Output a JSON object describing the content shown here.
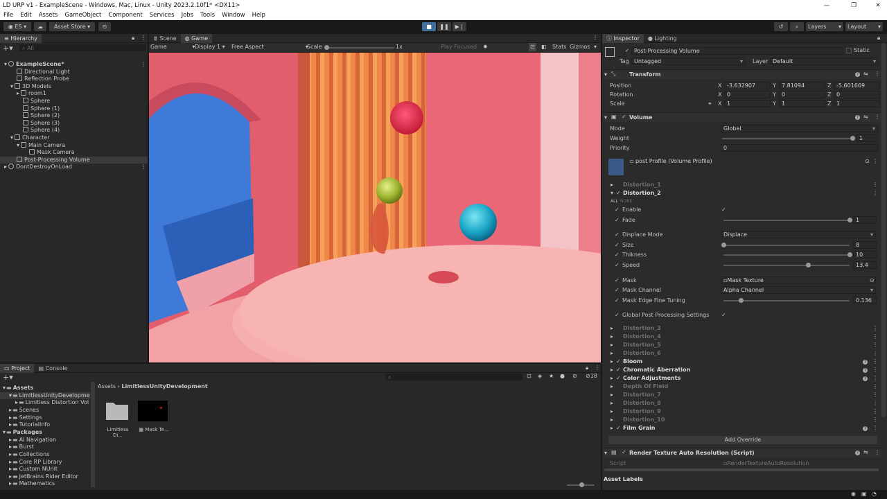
{
  "window": {
    "title": "LD URP v1 - ExampleScene - Windows, Mac, Linux - Unity 2023.2.10f1* <DX11>"
  },
  "menu": [
    "File",
    "Edit",
    "Assets",
    "GameObject",
    "Component",
    "Services",
    "Jobs",
    "Tools",
    "Window",
    "Help"
  ],
  "toolbar": {
    "account": "ES",
    "asset_store": "Asset Store",
    "layers": "Layers",
    "layout": "Layout"
  },
  "hierarchy": {
    "tab": "Hierarchy",
    "search_placeholder": "All",
    "items": [
      {
        "label": "ExampleScene*",
        "depth": 0,
        "bold": true,
        "expand": true,
        "type": "scene"
      },
      {
        "label": "Directional Light",
        "depth": 1
      },
      {
        "label": "Reflection Probe",
        "depth": 1
      },
      {
        "label": "3D Models",
        "depth": 1,
        "expand": true
      },
      {
        "label": "room1",
        "depth": 2,
        "expand": false
      },
      {
        "label": "Sphere",
        "depth": 2
      },
      {
        "label": "Sphere (1)",
        "depth": 2
      },
      {
        "label": "Sphere (2)",
        "depth": 2
      },
      {
        "label": "Sphere (3)",
        "depth": 2
      },
      {
        "label": "Sphere (4)",
        "depth": 2
      },
      {
        "label": "Character",
        "depth": 1,
        "expand": true
      },
      {
        "label": "Main Camera",
        "depth": 2,
        "expand": true
      },
      {
        "label": "Mask Camera",
        "depth": 3
      },
      {
        "label": "Post-Processing Volume",
        "depth": 1,
        "selected": true
      },
      {
        "label": "DontDestroyOnLoad",
        "depth": 0,
        "expand": false,
        "type": "scene"
      }
    ]
  },
  "game": {
    "tabs": [
      "Scene",
      "Game"
    ],
    "bar": {
      "mode": "Game",
      "display": "Display 1",
      "aspect": "Free Aspect",
      "scale_label": "Scale",
      "scale_value": "1x",
      "play_focused": "Play Focused",
      "stats": "Stats",
      "gizmos": "Gizmos"
    }
  },
  "inspector": {
    "tabs": [
      "Inspector",
      "Lighting"
    ],
    "object_name": "Post-Processing Volume",
    "static": "Static",
    "tag_label": "Tag",
    "tag": "Untagged",
    "layer_label": "Layer",
    "layer": "Default",
    "transform": {
      "title": "Transform",
      "position_label": "Position",
      "px": "-3.632907",
      "py": "7.81094",
      "pz": "-5.601669",
      "rotation_label": "Rotation",
      "rx": "0",
      "ry": "0",
      "rz": "0",
      "scale_label": "Scale",
      "sx": "1",
      "sy": "1",
      "sz": "1"
    },
    "volume": {
      "title": "Volume",
      "mode_label": "Mode",
      "mode": "Global",
      "weight_label": "Weight",
      "weight": "1",
      "weight_frac": 1.0,
      "priority_label": "Priority",
      "priority": "0",
      "profile": "post Profile (Volume Profile)"
    },
    "overrides_top": [
      "Distortion_1"
    ],
    "distortion2": {
      "title": "Distortion_2",
      "all": "ALL",
      "none": "NONE",
      "enable_label": "Enable",
      "fade_label": "Fade",
      "fade": "1",
      "fade_frac": 1.0,
      "displace_mode_label": "Displace Mode",
      "displace_mode": "Displace",
      "size_label": "Size",
      "size": "8",
      "size_frac": 0.0,
      "thickness_label": "Thikness",
      "thickness": "10",
      "thickness_frac": 1.0,
      "speed_label": "Speed",
      "speed": "13.4",
      "speed_frac": 0.67,
      "mask_label": "Mask",
      "mask": "Mask Texture",
      "mask_channel_label": "Mask Channel",
      "mask_channel": "Alpha Channel",
      "edge_label": "Mask Edge Fine Tuning",
      "edge": "0.136",
      "edge_frac": 0.136,
      "global_label": "Global Post Processing Settings"
    },
    "overrides": [
      {
        "label": "Distortion_3",
        "active": false
      },
      {
        "label": "Distortion_4",
        "active": false
      },
      {
        "label": "Distortion_5",
        "active": false
      },
      {
        "label": "Distortion_6",
        "active": false
      },
      {
        "label": "Bloom",
        "active": true
      },
      {
        "label": "Chromatic Aberration",
        "active": true
      },
      {
        "label": "Color Adjustments",
        "active": true
      },
      {
        "label": "Depth Of Field",
        "active": false
      },
      {
        "label": "Distortion_7",
        "active": false
      },
      {
        "label": "Distortion_8",
        "active": false
      },
      {
        "label": "Distortion_9",
        "active": false
      },
      {
        "label": "Distortion_10",
        "active": false
      },
      {
        "label": "Film Grain",
        "active": true
      }
    ],
    "add_override": "Add Override",
    "script_comp": {
      "title": "Render Texture Auto Resolution (Script)",
      "script_label": "Script",
      "script": "RenderTextureAutoResolution"
    },
    "asset_labels": "Asset Labels"
  },
  "project": {
    "tabs": [
      "Project",
      "Console"
    ],
    "tree": [
      {
        "label": "Assets",
        "depth": 0,
        "bold": true
      },
      {
        "label": "LimitlessUnityDevelopme",
        "depth": 1,
        "selected": true
      },
      {
        "label": "Limitless Distortion Vol",
        "depth": 2
      },
      {
        "label": "Scenes",
        "depth": 1
      },
      {
        "label": "Settings",
        "depth": 1
      },
      {
        "label": "TutorialInfo",
        "depth": 1
      },
      {
        "label": "Packages",
        "depth": 0,
        "bold": true
      },
      {
        "label": "AI Navigation",
        "depth": 1
      },
      {
        "label": "Burst",
        "depth": 1
      },
      {
        "label": "Collections",
        "depth": 1
      },
      {
        "label": "Core RP Library",
        "depth": 1
      },
      {
        "label": "Custom NUnit",
        "depth": 1
      },
      {
        "label": "JetBrains Rider Editor",
        "depth": 1
      },
      {
        "label": "Mathematics",
        "depth": 1
      }
    ],
    "breadcrumb": [
      "Assets",
      "LimitlessUnityDevelopment"
    ],
    "assets": [
      {
        "label": "Limitless Di..."
      },
      {
        "label": "Mask Te..."
      }
    ],
    "count": "18"
  },
  "colors": {
    "accent": "#2c5d87",
    "wall_pink": "#e8787e",
    "floor": "#f3a7a6",
    "blue": "#3a74d8"
  }
}
